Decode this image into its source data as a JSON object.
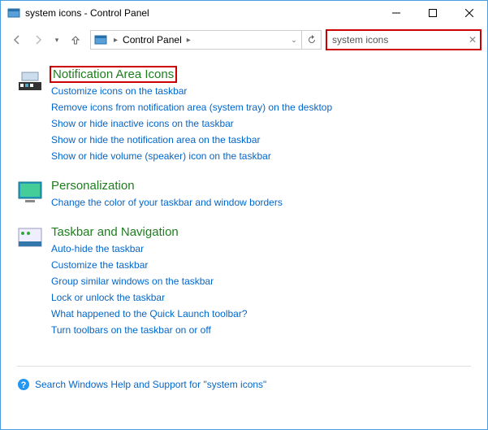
{
  "title": "system icons - Control Panel",
  "breadcrumb": {
    "root": "Control Panel"
  },
  "search": {
    "value": "system icons"
  },
  "sections": [
    {
      "title": "Notification Area Icons",
      "highlighted": true,
      "links": [
        "Customize icons on the taskbar",
        "Remove icons from notification area (system tray) on the desktop",
        "Show or hide inactive icons on the taskbar",
        "Show or hide the notification area on the taskbar",
        "Show or hide volume (speaker) icon on the taskbar"
      ]
    },
    {
      "title": "Personalization",
      "highlighted": false,
      "links": [
        "Change the color of your taskbar and window borders"
      ]
    },
    {
      "title": "Taskbar and Navigation",
      "highlighted": false,
      "links": [
        "Auto-hide the taskbar",
        "Customize the taskbar",
        "Group similar windows on the taskbar",
        "Lock or unlock the taskbar",
        "What happened to the Quick Launch toolbar?",
        "Turn toolbars on the taskbar on or off"
      ]
    }
  ],
  "help": {
    "text": "Search Windows Help and Support for \"system icons\""
  }
}
